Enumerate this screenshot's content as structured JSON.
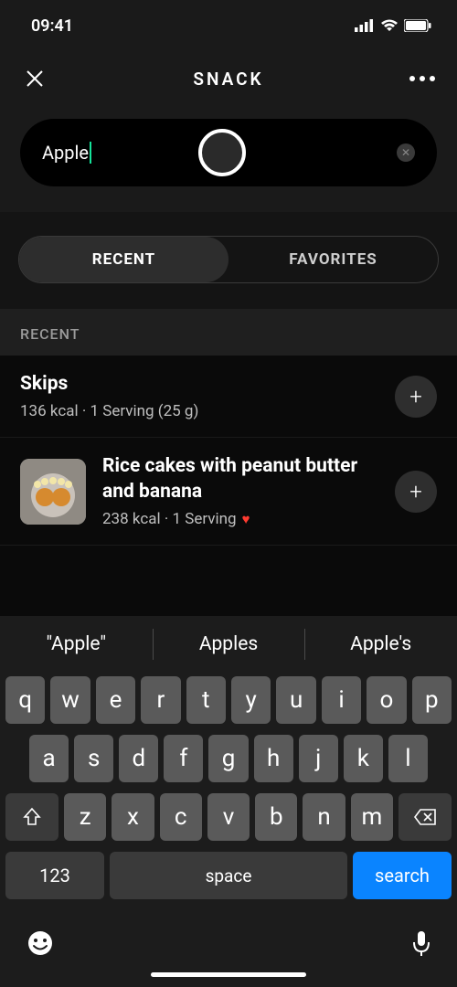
{
  "status": {
    "time": "09:41"
  },
  "header": {
    "title": "SNACK"
  },
  "search": {
    "value": "Apple"
  },
  "tabs": {
    "recent": "RECENT",
    "favorites": "FAVORITES"
  },
  "section_label": "RECENT",
  "items": [
    {
      "title": "Skips",
      "meta": "136 kcal · 1 Serving (25 g)",
      "favorite": false,
      "thumb": false
    },
    {
      "title": "Rice cakes with peanut butter and banana",
      "meta": "238 kcal · 1 Serving",
      "favorite": true,
      "thumb": true
    }
  ],
  "suggestions": [
    "\"Apple\"",
    "Apples",
    "Apple's"
  ],
  "keys": {
    "row1": [
      "q",
      "w",
      "e",
      "r",
      "t",
      "y",
      "u",
      "i",
      "o",
      "p"
    ],
    "row2": [
      "a",
      "s",
      "d",
      "f",
      "g",
      "h",
      "j",
      "k",
      "l"
    ],
    "row3": [
      "z",
      "x",
      "c",
      "v",
      "b",
      "n",
      "m"
    ],
    "numbers": "123",
    "space": "space",
    "search": "search"
  }
}
